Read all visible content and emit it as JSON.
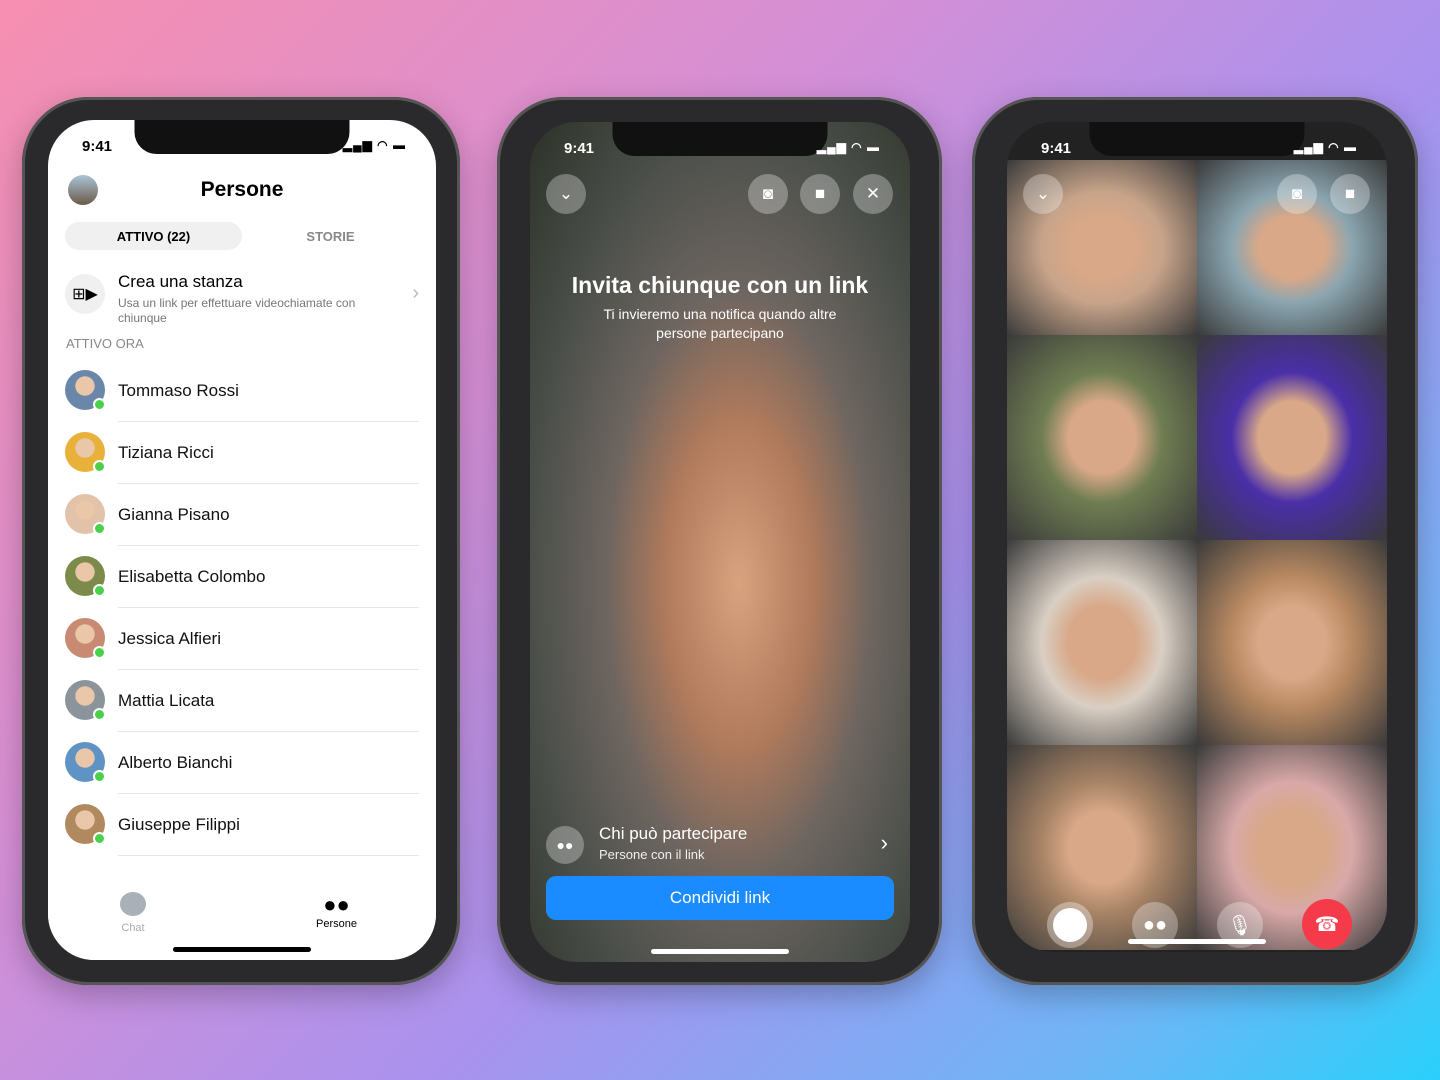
{
  "status": {
    "time": "9:41",
    "signal": "▂▄▆█",
    "wifi": "wifi-icon",
    "battery": "battery-icon"
  },
  "phone1": {
    "title": "Persone",
    "tabs": [
      {
        "label": "ATTIVO (22)",
        "active": true
      },
      {
        "label": "STORIE",
        "active": false
      }
    ],
    "room": {
      "title": "Crea una stanza",
      "desc": "Usa un link per effettuare videochiamate con chiunque"
    },
    "section": "ATTIVO ORA",
    "contacts": [
      {
        "name": "Tommaso Rossi",
        "color": "#6a86a8"
      },
      {
        "name": "Tiziana Ricci",
        "color": "#e8b13a"
      },
      {
        "name": "Gianna Pisano",
        "color": "#e2c2a8"
      },
      {
        "name": "Elisabetta Colombo",
        "color": "#7c8a4a"
      },
      {
        "name": "Jessica Alfieri",
        "color": "#c98a74"
      },
      {
        "name": "Mattia Licata",
        "color": "#8b949b"
      },
      {
        "name": "Alberto Bianchi",
        "color": "#5f93c4"
      },
      {
        "name": "Giuseppe Filippi",
        "color": "#b0895e"
      }
    ],
    "tabbar": [
      {
        "label": "Chat",
        "icon": "chat-bubble-icon",
        "active": false
      },
      {
        "label": "Persone",
        "icon": "people-icon",
        "active": true
      }
    ]
  },
  "phone2": {
    "heading": "Invita chiunque con un link",
    "subheading": "Ti invieremo una notifica quando altre persone partecipano",
    "who": {
      "title": "Chi può partecipare",
      "desc": "Persone con il link"
    },
    "share_button": "Condividi link"
  },
  "phone3": {
    "tiles": [
      "#c7a48a",
      "#8aa5b0",
      "#6f7d52",
      "#4a2fa8",
      "#d9cfc4",
      "#b98a62",
      "#a88466",
      "#d8a9a8"
    ]
  }
}
